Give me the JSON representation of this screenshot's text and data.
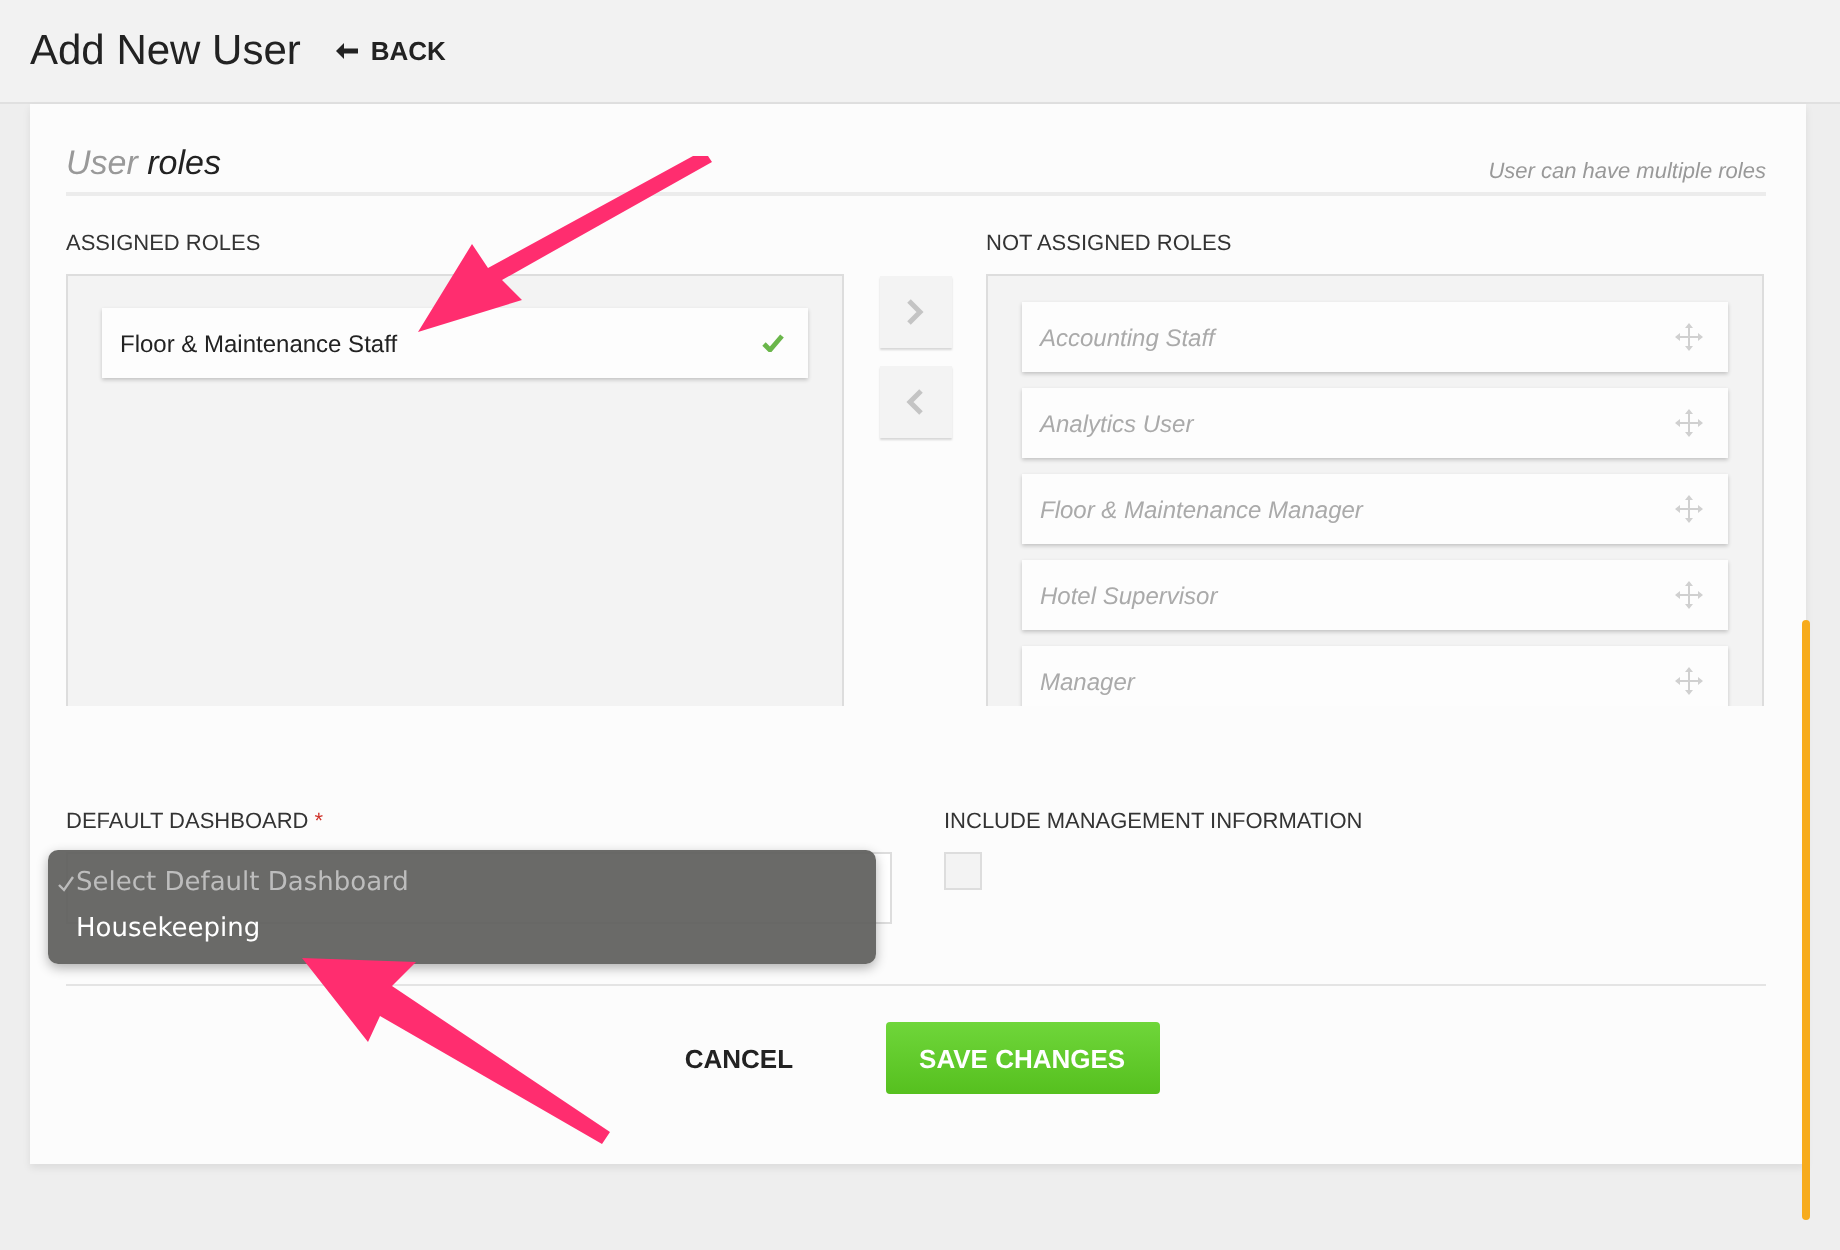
{
  "header": {
    "title": "Add New User",
    "back_link": "BACK"
  },
  "section": {
    "title_light": "User",
    "title_strong": "roles",
    "hint": "User can have multiple roles"
  },
  "assigned": {
    "label": "ASSIGNED ROLES",
    "items": [
      {
        "name": "Floor & Maintenance Staff"
      }
    ]
  },
  "not_assigned": {
    "label": "NOT ASSIGNED ROLES",
    "items": [
      {
        "name": "Accounting Staff"
      },
      {
        "name": "Analytics User"
      },
      {
        "name": "Floor & Maintenance Manager"
      },
      {
        "name": "Hotel Supervisor"
      },
      {
        "name": "Manager"
      }
    ]
  },
  "default_dashboard": {
    "label": "DEFAULT DASHBOARD",
    "required_mark": "*",
    "options": [
      {
        "label": "Select Default Dashboard",
        "selected": true
      },
      {
        "label": "Housekeeping",
        "selected": false
      }
    ]
  },
  "include_management": {
    "label": "INCLUDE MANAGEMENT INFORMATION",
    "checked": false
  },
  "buttons": [
    {
      "kind": "secondary",
      "label": "CANCEL"
    },
    {
      "kind": "primary",
      "label": "SAVE CHANGES"
    }
  ]
}
